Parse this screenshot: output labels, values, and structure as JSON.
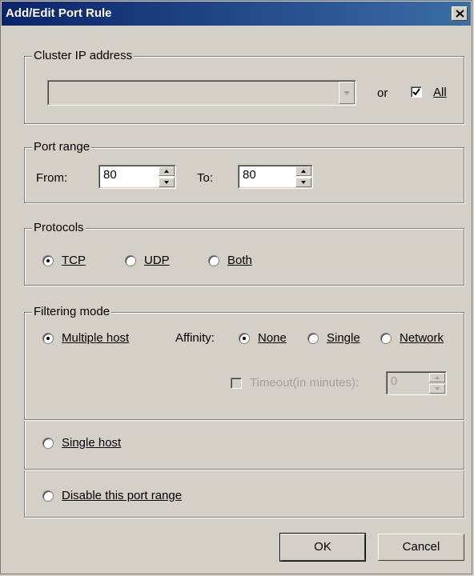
{
  "window": {
    "title": "Add/Edit Port Rule",
    "close_glyph": "close-icon"
  },
  "cluster_ip": {
    "group_label": "Cluster IP address",
    "address_value": "",
    "or_label": "or",
    "all_label": "All",
    "all_checked": true
  },
  "port_range": {
    "group_label": "Port range",
    "from_label": "From:",
    "from_value": "80",
    "to_label": "To:",
    "to_value": "80"
  },
  "protocols": {
    "group_label": "Protocols",
    "options": [
      "TCP",
      "UDP",
      "Both"
    ],
    "selected": "TCP"
  },
  "filtering": {
    "group_label": "Filtering mode",
    "multiple_host_label": "Multiple host",
    "multiple_host_selected": true,
    "affinity_label": "Affinity:",
    "affinity_options": [
      "None",
      "Single",
      "Network"
    ],
    "affinity_selected": "None",
    "timeout_label": "Timeout(in minutes):",
    "timeout_value": "0",
    "timeout_enabled": false,
    "single_host_label": "Single host",
    "disable_label": "Disable this port range"
  },
  "buttons": {
    "ok_label": "OK",
    "cancel_label": "Cancel"
  }
}
